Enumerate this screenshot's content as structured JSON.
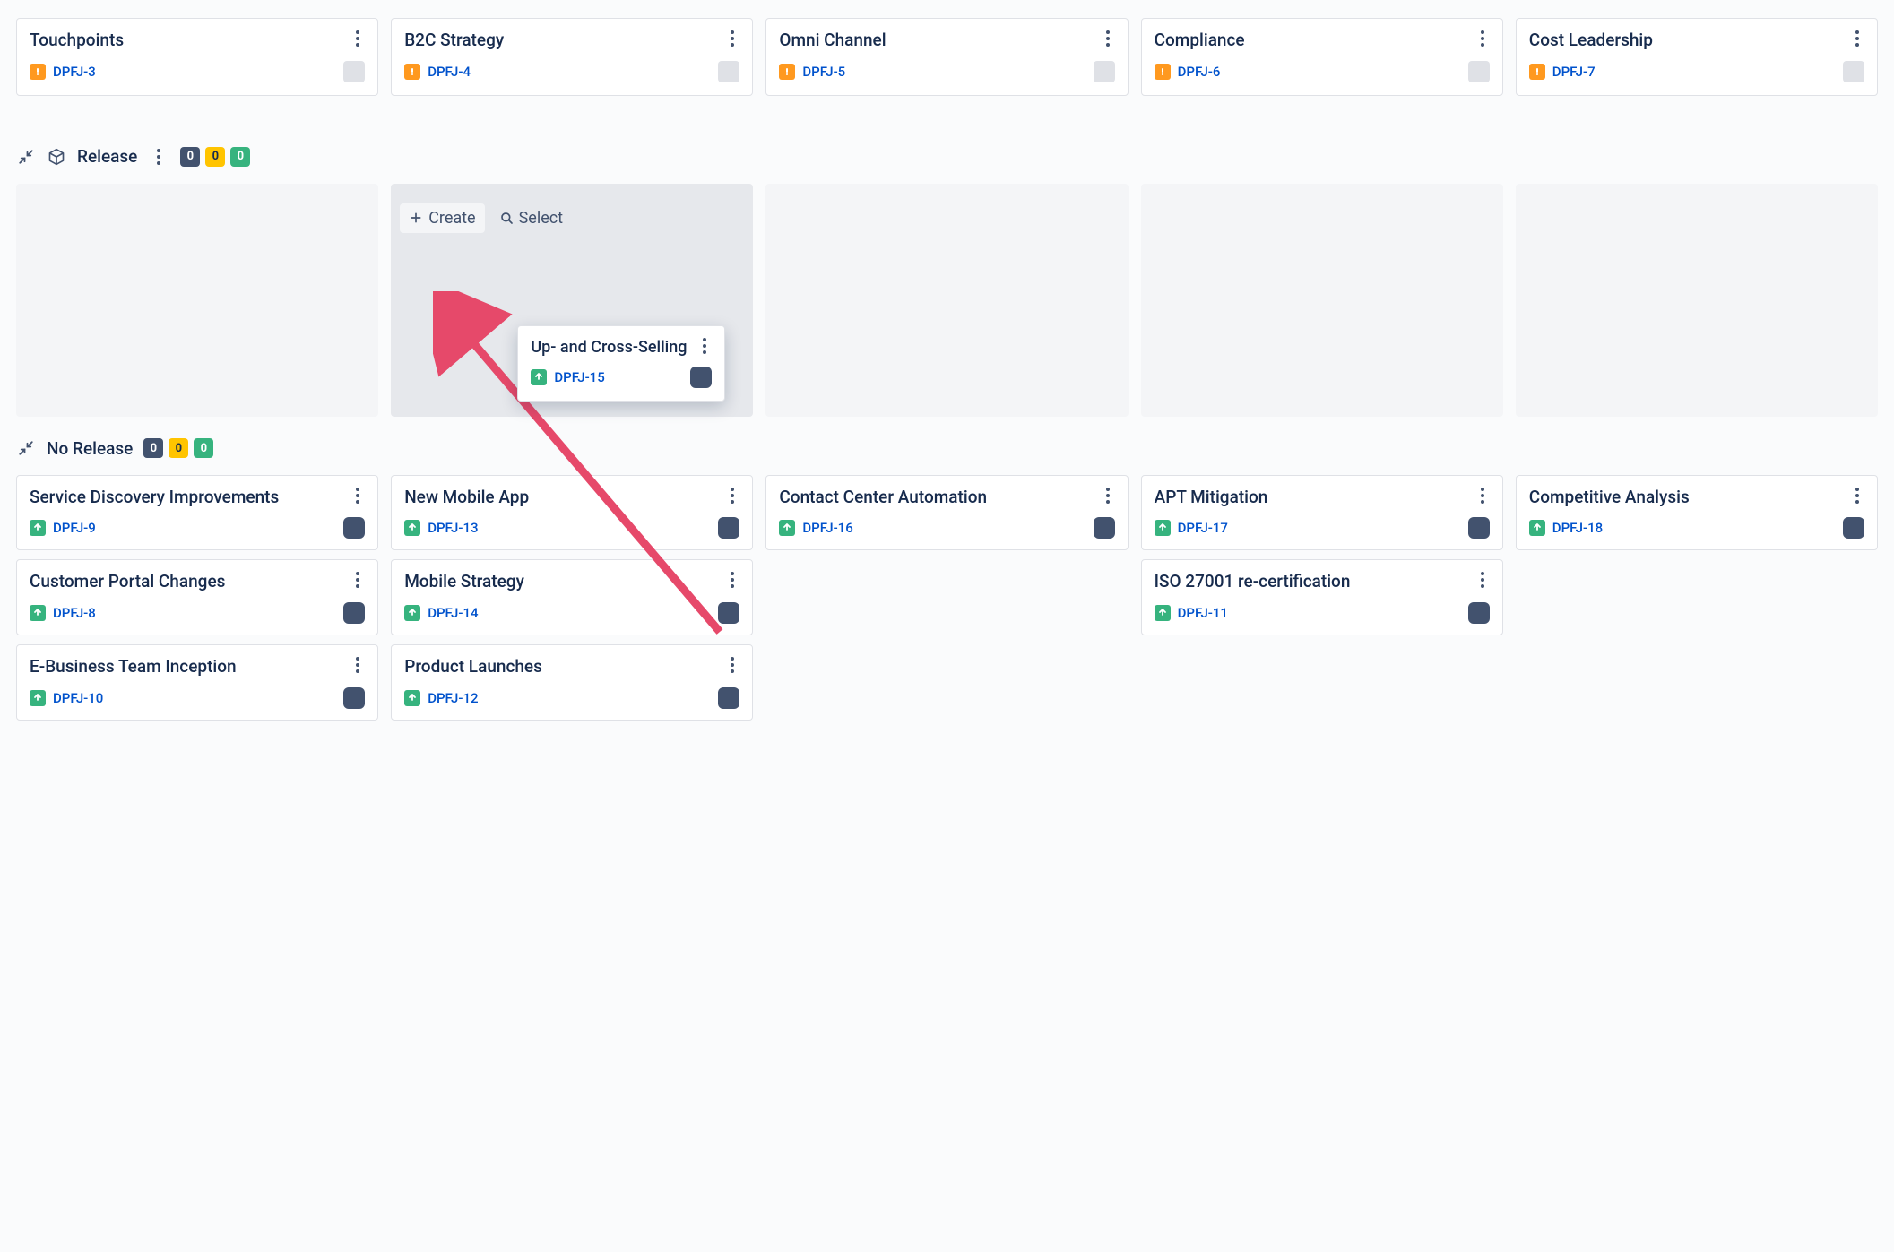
{
  "top_cards": [
    {
      "title": "Touchpoints",
      "key": "DPFJ-3",
      "icon": "orange"
    },
    {
      "title": "B2C Strategy",
      "key": "DPFJ-4",
      "icon": "orange"
    },
    {
      "title": "Omni Channel",
      "key": "DPFJ-5",
      "icon": "orange"
    },
    {
      "title": "Compliance",
      "key": "DPFJ-6",
      "icon": "orange"
    },
    {
      "title": "Cost Leadership",
      "key": "DPFJ-7",
      "icon": "orange"
    }
  ],
  "release": {
    "title": "Release",
    "create_label": "Create",
    "select_label": "Select",
    "counts": [
      "0",
      "0",
      "0"
    ],
    "dragging_card": {
      "title": "Up- and Cross-Selling",
      "key": "DPFJ-15",
      "icon": "green"
    }
  },
  "no_release": {
    "title": "No Release",
    "counts": [
      "0",
      "0",
      "0"
    ],
    "columns": [
      [
        {
          "title": "Service Discovery Improvements",
          "key": "DPFJ-9",
          "icon": "green"
        },
        {
          "title": "Customer Portal Changes",
          "key": "DPFJ-8",
          "icon": "green"
        },
        {
          "title": "E-Business Team Inception",
          "key": "DPFJ-10",
          "icon": "green"
        }
      ],
      [
        {
          "title": "New Mobile App",
          "key": "DPFJ-13",
          "icon": "green"
        },
        {
          "title": "Mobile Strategy",
          "key": "DPFJ-14",
          "icon": "green"
        },
        {
          "title": "Product Launches",
          "key": "DPFJ-12",
          "icon": "green"
        }
      ],
      [
        {
          "title": "Contact Center Automation",
          "key": "DPFJ-16",
          "icon": "green"
        }
      ],
      [
        {
          "title": "APT Mitigation",
          "key": "DPFJ-17",
          "icon": "green"
        },
        {
          "title": "ISO 27001 re-certification",
          "key": "DPFJ-11",
          "icon": "green"
        }
      ],
      [
        {
          "title": "Competitive Analysis",
          "key": "DPFJ-18",
          "icon": "green"
        }
      ]
    ]
  }
}
